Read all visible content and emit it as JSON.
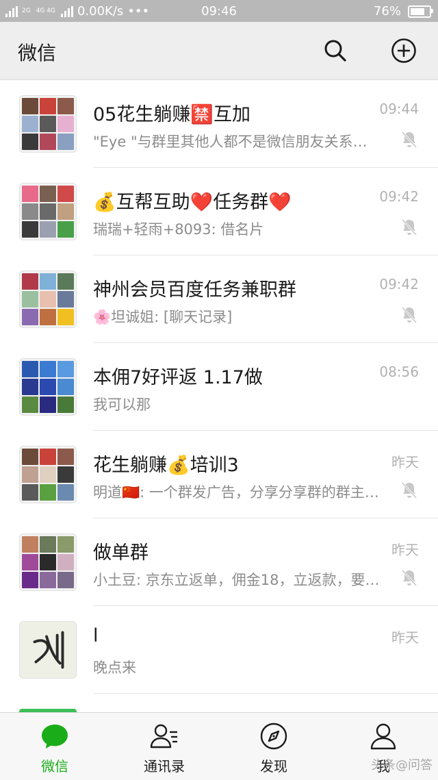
{
  "status_bar": {
    "network_top": "2G",
    "network_mid": "4G 4G",
    "speed": "0.00K/s",
    "dots": "•••",
    "time": "09:46",
    "battery": "76%",
    "battery_level": 0.76
  },
  "header": {
    "title": "微信"
  },
  "chats": [
    {
      "name": "05花生躺赚🈲互加",
      "preview": "\"Eye \"与群里其他人都不是微信朋友关系，请注意隐私安全",
      "time": "09:44",
      "muted": true,
      "avatar_colors": [
        "#6b4a3a",
        "#c9433b",
        "#8b5a4a",
        "#9bb1cf",
        "#5a5a5a",
        "#e6b0d0",
        "#3a3a3a",
        "#b0485a",
        "#8aa0c0"
      ]
    },
    {
      "name": "💰互帮互助❤️任务群❤️",
      "preview": "瑞瑞+轻雨+8093: 借名片",
      "time": "09:42",
      "muted": true,
      "avatar_colors": [
        "#e86a8a",
        "#7a6050",
        "#d04a4a",
        "#8a8a8a",
        "#6a6a6a",
        "#c0a080",
        "#3a3a3a",
        "#9aa0b0",
        "#4aa04a"
      ]
    },
    {
      "name": "神州会员百度任务兼职群",
      "preview": "🌸坦诚姐: [聊天记录]",
      "time": "09:42",
      "muted": true,
      "avatar_colors": [
        "#b03a4a",
        "#7fb0d8",
        "#5a7a5a",
        "#9ac0a0",
        "#e8c0b0",
        "#6a7a9a",
        "#8a6ab0",
        "#c07040",
        "#f0c020"
      ]
    },
    {
      "name": "本佣7好评返 1.17做",
      "preview": "我可以那",
      "time": "08:56",
      "muted": false,
      "avatar_colors": [
        "#2a5ab0",
        "#3a7ad0",
        "#5a9ae0",
        "#2a3a90",
        "#2a4ab0",
        "#4a8ad0",
        "#5a8a40",
        "#2a2a80",
        "#4a7a3a"
      ]
    },
    {
      "name": "花生躺赚💰培训3",
      "preview": "明道🇨🇳: 一个群发广告，分享分享群的群主，被群友举报后",
      "time": "昨天",
      "muted": true,
      "avatar_colors": [
        "#6b4a3a",
        "#c9433b",
        "#8b5a4a",
        "#c0a090",
        "#e0d0c0",
        "#3a3a3a",
        "#5a5a5a",
        "#5aa040",
        "#6a8ab0"
      ]
    },
    {
      "name": "做单群",
      "preview": "小土豆: 京东立返单，佣金18，立返款，要的联系我",
      "time": "昨天",
      "muted": true,
      "avatar_colors": [
        "#c08060",
        "#6a7a5a",
        "#8a9a6a",
        "#a04a9a",
        "#2a2a2a",
        "#d0b0c0",
        "#6a2a8a",
        "#8a6a9a",
        "#7a6a8a"
      ]
    },
    {
      "name": "l",
      "preview": "晚点来",
      "time": "昨天",
      "muted": false,
      "avatar_colors": []
    }
  ],
  "tabs": [
    {
      "label": "微信",
      "icon": "chat-bubble-icon",
      "active": true
    },
    {
      "label": "通讯录",
      "icon": "contacts-icon",
      "active": false
    },
    {
      "label": "发现",
      "icon": "compass-icon",
      "active": false
    },
    {
      "label": "我",
      "icon": "person-icon",
      "active": false
    }
  ],
  "watermark": "头条@问答",
  "colors": {
    "accent": "#1aad19",
    "header_bg": "#eeeeee",
    "status_bg": "#b8b8b8"
  }
}
